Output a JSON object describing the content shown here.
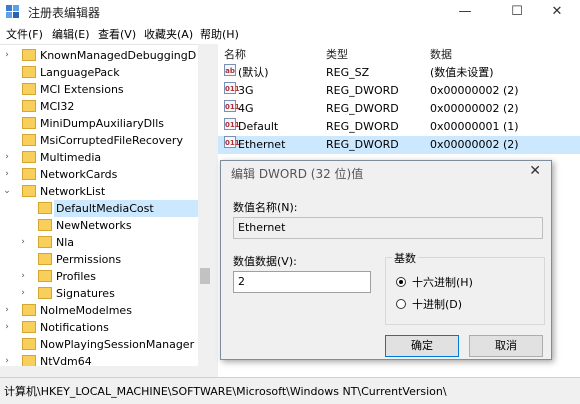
{
  "window": {
    "title": "注册表编辑器",
    "minimize_icon": "minimize-icon",
    "maximize_icon": "maximize-icon",
    "close_icon": "close-icon"
  },
  "menu": [
    "文件(F)",
    "编辑(E)",
    "查看(V)",
    "收藏夹(A)",
    "帮助(H)"
  ],
  "tree": [
    {
      "label": "KnownManagedDebuggingD",
      "indent": 1,
      "expander": "›"
    },
    {
      "label": "LanguagePack",
      "indent": 1,
      "expander": ""
    },
    {
      "label": "MCI Extensions",
      "indent": 1,
      "expander": ""
    },
    {
      "label": "MCI32",
      "indent": 1,
      "expander": ""
    },
    {
      "label": "MiniDumpAuxiliaryDlls",
      "indent": 1,
      "expander": ""
    },
    {
      "label": "MsiCorruptedFileRecovery",
      "indent": 1,
      "expander": ""
    },
    {
      "label": "Multimedia",
      "indent": 1,
      "expander": "›"
    },
    {
      "label": "NetworkCards",
      "indent": 1,
      "expander": "›"
    },
    {
      "label": "NetworkList",
      "indent": 1,
      "expander": "⌄"
    },
    {
      "label": "DefaultMediaCost",
      "indent": 2,
      "expander": "",
      "selected": true
    },
    {
      "label": "NewNetworks",
      "indent": 2,
      "expander": ""
    },
    {
      "label": "Nla",
      "indent": 2,
      "expander": "›"
    },
    {
      "label": "Permissions",
      "indent": 2,
      "expander": ""
    },
    {
      "label": "Profiles",
      "indent": 2,
      "expander": "›"
    },
    {
      "label": "Signatures",
      "indent": 2,
      "expander": "›"
    },
    {
      "label": "NoImeModelmes",
      "indent": 1,
      "expander": "›"
    },
    {
      "label": "Notifications",
      "indent": 1,
      "expander": "›"
    },
    {
      "label": "NowPlayingSessionManager",
      "indent": 1,
      "expander": ""
    },
    {
      "label": "NtVdm64",
      "indent": 1,
      "expander": "›"
    }
  ],
  "list": {
    "columns": [
      "名称",
      "类型",
      "数据"
    ],
    "rows": [
      {
        "icon": "ab",
        "name": "(默认)",
        "type": "REG_SZ",
        "data": "(数值未设置)"
      },
      {
        "icon": "011",
        "name": "3G",
        "type": "REG_DWORD",
        "data": "0x00000002 (2)"
      },
      {
        "icon": "011",
        "name": "4G",
        "type": "REG_DWORD",
        "data": "0x00000002 (2)"
      },
      {
        "icon": "011",
        "name": "Default",
        "type": "REG_DWORD",
        "data": "0x00000001 (1)"
      },
      {
        "icon": "011",
        "name": "Ethernet",
        "type": "REG_DWORD",
        "data": "0x00000002 (2)",
        "selected": true
      }
    ]
  },
  "dialog": {
    "title": "编辑 DWORD (32 位)值",
    "close": "✕",
    "name_label": "数值名称(N):",
    "name_value": "Ethernet",
    "data_label": "数值数据(V):",
    "data_value": "2",
    "base_label": "基数",
    "hex_label": "十六进制(H)",
    "dec_label": "十进制(D)",
    "selected_base": "hex",
    "ok_label": "确定",
    "cancel_label": "取消"
  },
  "status": "计算机\\HKEY_LOCAL_MACHINE\\SOFTWARE\\Microsoft\\Windows NT\\CurrentVersion\\"
}
